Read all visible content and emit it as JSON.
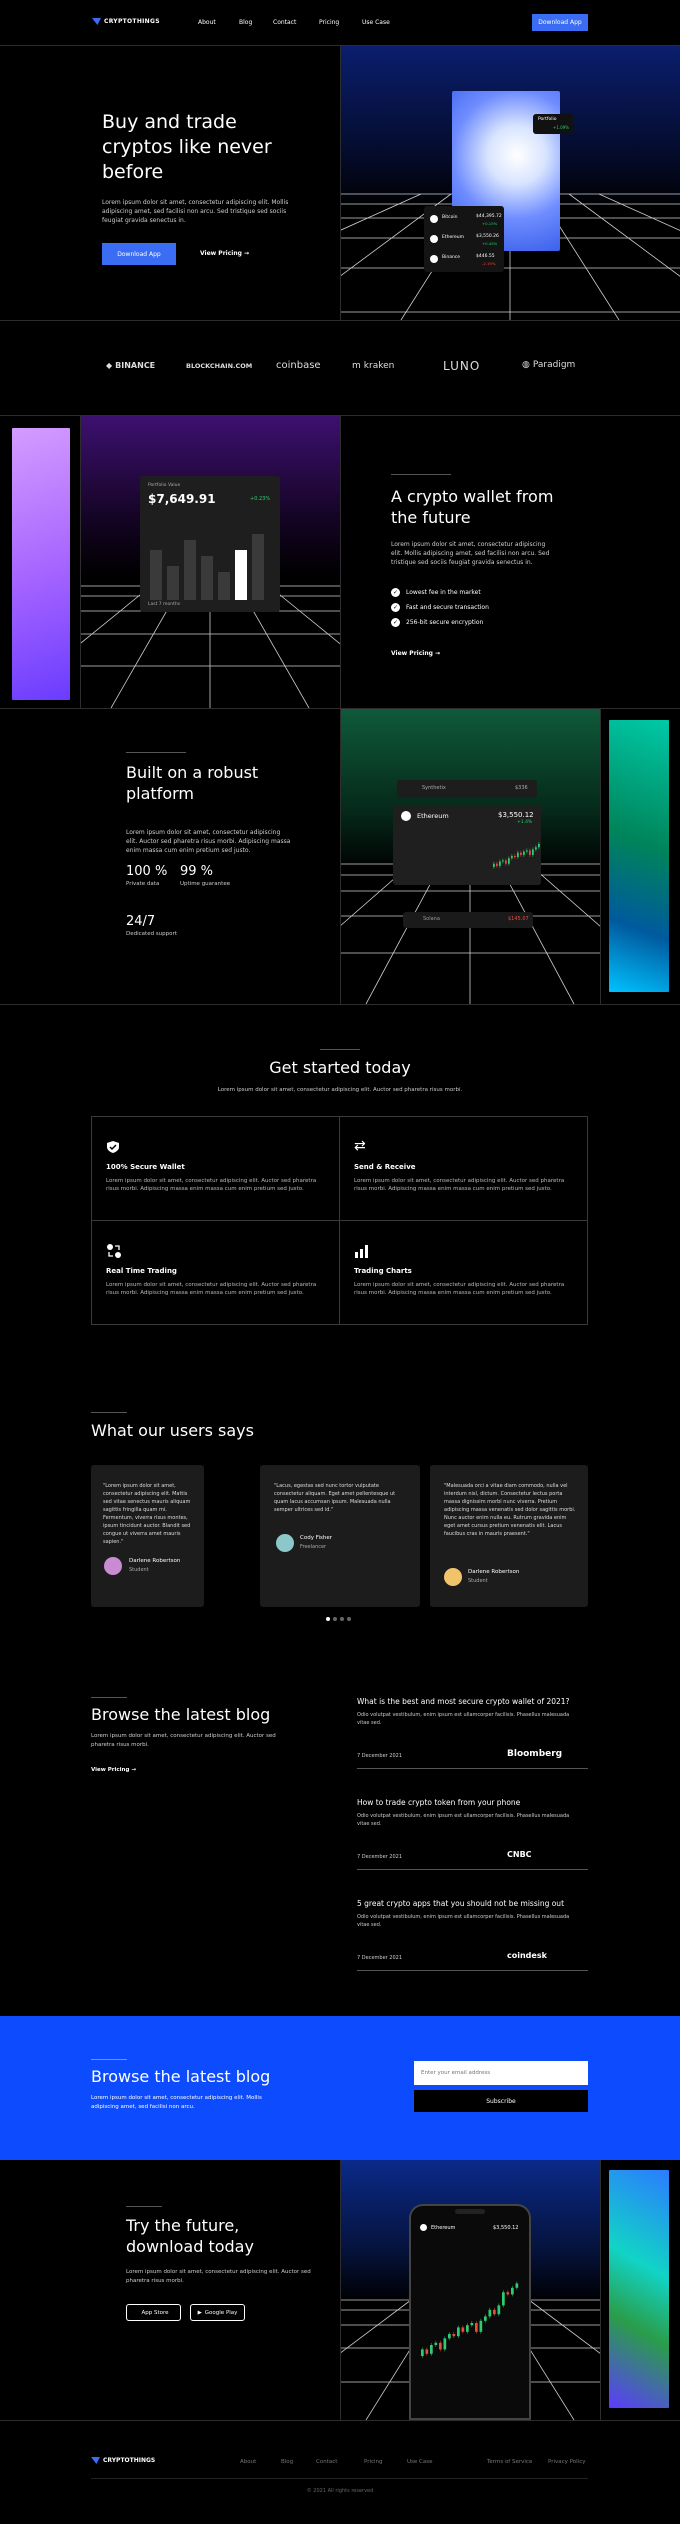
{
  "nav": {
    "brand": "CRYPTOTHINGS",
    "links": [
      "About",
      "Blog",
      "Contact",
      "Pricing",
      "Use Case"
    ],
    "cta": "Download App"
  },
  "hero": {
    "title": "Buy and trade cryptos like never before",
    "body": "Lorem ipsum dolor sit amet, consectetur adipiscing elit. Mollis adipiscing amet, sed facilisi non arcu. Sed tristique sed sociis feugiat gravida senectus in.",
    "cta": "Download App",
    "pricing_link": "View Pricing",
    "portfolio_label": "Portfolio",
    "portfolio_value": "+1.09%",
    "coins": [
      {
        "name": "Bitcoin",
        "price": "$44,395.72",
        "change": "+0.15%"
      },
      {
        "name": "Ethereum",
        "price": "$3,550.26",
        "change": "+0.45%"
      },
      {
        "name": "Binance",
        "price": "$446.55",
        "change": "-2.19%"
      }
    ]
  },
  "partners": [
    "BINANCE",
    "BLOCKCHAIN.COM",
    "coinbase",
    "kraken",
    "LUNO",
    "Paradigm"
  ],
  "wallet": {
    "card_label": "Portfolio Value",
    "card_value": "$7,649.91",
    "card_change": "+0.23%",
    "card_footer": "Last 7 months",
    "title": "A crypto wallet from the future",
    "body": "Lorem ipsum dolor sit amet, consectetur adipiscing elit. Mollis adipiscing amet, sed facilisi non arcu. Sed tristique sed sociis feugiat gravida senectus in.",
    "bullets": [
      "Lowest fee in the market",
      "Fast and secure transaction",
      "256-bit secure encryption"
    ],
    "link": "View Pricing"
  },
  "platform": {
    "title": "Built on a robust platform",
    "body": "Lorem ipsum dolor sit amet, consectetur adipiscing elit. Auctor sed pharetra risus morbi. Adipiscing massa enim massa cum enim pretium sed justo.",
    "stats": [
      {
        "value": "100 %",
        "label": "Private data"
      },
      {
        "value": "99 %",
        "label": "Uptime guarantee"
      },
      {
        "value": "24/7",
        "label": "Dedicated support"
      }
    ],
    "coin_top": "Synthetix",
    "coin_top_price": "$336",
    "coin_main": "Ethereum",
    "coin_main_price": "$3,550.12",
    "coin_main_change": "+1.4%",
    "coin_bottom": "Solana",
    "coin_bottom_price": "$145.07"
  },
  "started": {
    "title": "Get started today",
    "subtitle": "Lorem ipsum dolor sit amet, consectetur adipiscing elit. Auctor sed pharetra risus morbi.",
    "features": [
      {
        "title": "100% Secure Wallet",
        "desc": "Lorem ipsum dolor sit amet, consectetur adipiscing elit. Auctor sed pharetra risus morbi. Adipiscing massa enim massa cum enim pretium sed justo."
      },
      {
        "title": "Send & Receive",
        "desc": "Lorem ipsum dolor sit amet, consectetur adipiscing elit. Auctor sed pharetra risus morbi. Adipiscing massa enim massa cum enim pretium sed justo."
      },
      {
        "title": "Real Time Trading",
        "desc": "Lorem ipsum dolor sit amet, consectetur adipiscing elit. Auctor sed pharetra risus morbi. Adipiscing massa enim massa cum enim pretium sed justo."
      },
      {
        "title": "Trading Charts",
        "desc": "Lorem ipsum dolor sit amet, consectetur adipiscing elit. Auctor sed pharetra risus morbi. Adipiscing massa enim massa cum enim pretium sed justo."
      }
    ]
  },
  "testimonials": {
    "title": "What our users says",
    "items": [
      {
        "quote": "\"Lorem ipsum dolor sit amet, consectetur adipiscing elit. Mattis sed vitae senectus mauris aliquam sagittis fringilla quam mi. Fermentum, viverra risus montes, ipsum tincidunt auctor. Blandit sed congue ut viverra amet mauris sapien.\"",
        "name": "Darlene Robertson",
        "role": "Student"
      },
      {
        "quote": "\"Lacus, egestas sed nunc tortor vulputate consectetur aliquam. Eget amet pellentesque ut quam lacus accumsan ipsum. Malesuada nulla semper ultrices sed id.\"",
        "name": "Cody Fisher",
        "role": "Freelancer"
      },
      {
        "quote": "\"Malesuada orci a vitae diam commodo, nulla vel interdum nisl, dictum. Consectetur lectus porta massa dignissim morbi nunc viverra. Pretium adipiscing massa venenatis sed dolor sagittis morbi. Nunc auctor enim nulla eu. Rutrum gravida enim eget amet cursus pretium venenatis elit. Lacus faucibus cras in mauris praesent.\"",
        "name": "Darlene Robertson",
        "role": "Student"
      }
    ]
  },
  "blog": {
    "title": "Browse the latest blog",
    "body": "Lorem ipsum dolor sit amet, consectetur adipiscing elit. Auctor sed pharetra risus morbi.",
    "link": "View Pricing",
    "posts": [
      {
        "title": "What is the best and most secure crypto wallet of 2021?",
        "excerpt": "Odio volutpat vestibulum, enim ipsum est ullamcorper facilisis. Phasellus malesuada vitae sed.",
        "date": "7 December 2021",
        "source": "Bloomberg"
      },
      {
        "title": "How to trade crypto token from your phone",
        "excerpt": "Odio volutpat vestibulum, enim ipsum est ullamcorper facilisis. Phasellus malesuada vitae sed.",
        "date": "7 December 2021",
        "source": "CNBC"
      },
      {
        "title": "5 great crypto apps that you should not be missing out",
        "excerpt": "Odio volutpat vestibulum, enim ipsum est ullamcorper facilisis. Phasellus malesuada vitae sed.",
        "date": "7 December 2021",
        "source": "coindesk"
      }
    ]
  },
  "subscribe": {
    "title": "Browse the latest blog",
    "body": "Lorem ipsum dolor sit amet, consectetur adipiscing elit. Mollis adipiscing amet, sed facilisi non arcu.",
    "placeholder": "Enter your email address",
    "button": "Subscribe"
  },
  "download": {
    "title": "Try the future, download today",
    "body": "Lorem ipsum dolor sit amet, consectetur adipiscing elit. Auctor sed pharetra risus morbi.",
    "app_store": "App Store",
    "google_play": "Google Play",
    "phone_coin": "Ethereum",
    "phone_price": "$3,550.12"
  },
  "footer": {
    "brand": "CRYPTOTHINGS",
    "links": [
      "About",
      "Blog",
      "Contact",
      "Pricing",
      "Use Case"
    ],
    "legal": [
      "Terms of Service",
      "Privacy Policy"
    ],
    "copyright": "© 2021 All rights reserved"
  },
  "colors": {
    "accent": "#3b6cf4",
    "subscribe_bg": "#0d4bff",
    "positive": "#2ecc71",
    "negative": "#e74c3c"
  }
}
